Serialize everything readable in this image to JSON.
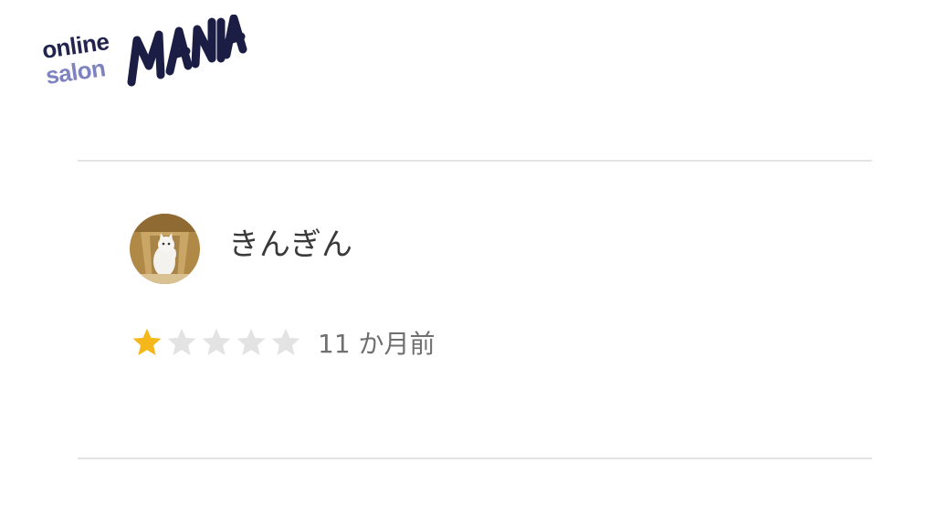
{
  "logo": {
    "line1": "online",
    "line2": "salon",
    "wordmark": "MANIA",
    "colors": {
      "online": "#22244f",
      "salon": "#7e82bf",
      "mania": "#1b1d45"
    }
  },
  "review": {
    "reviewer_name": "きんぎん",
    "avatar_icon": "cat-in-box-avatar-icon",
    "rating": 1,
    "rating_max": 5,
    "time_ago": "11 か月前",
    "colors": {
      "star_filled": "#f5b71a",
      "star_empty": "#e3e3e3",
      "divider": "#e4e4e4"
    }
  }
}
